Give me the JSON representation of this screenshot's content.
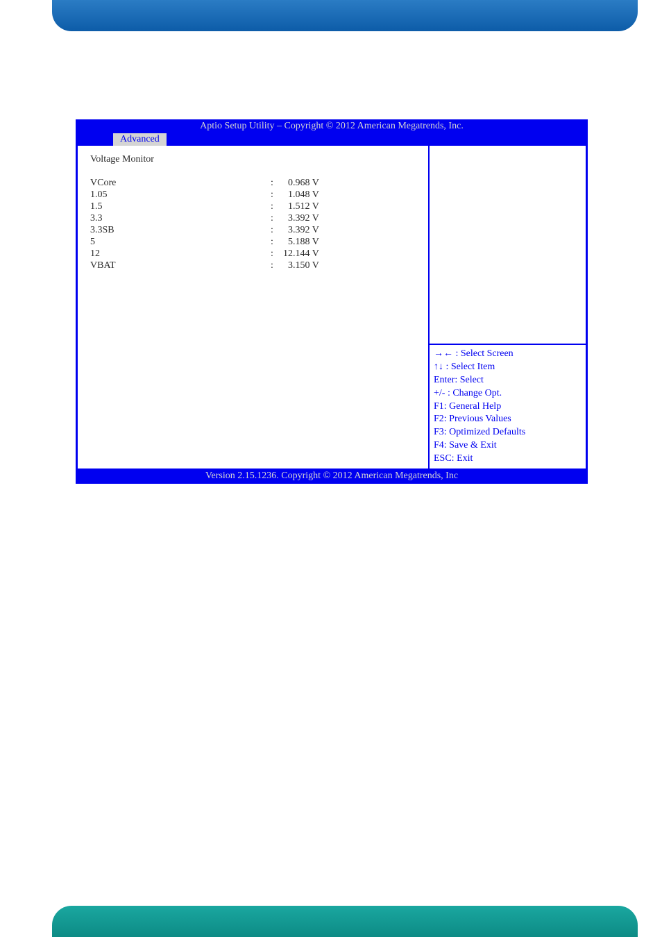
{
  "header": {
    "title": "Aptio Setup Utility  –  Copyright © 2012 American Megatrends, Inc."
  },
  "tabs": [
    {
      "label": "Advanced"
    }
  ],
  "main": {
    "section_title": "Voltage Monitor",
    "readings": [
      {
        "label": "VCore",
        "value": "  0.968 V"
      },
      {
        "label": "1.05",
        "value": "  1.048 V"
      },
      {
        "label": "1.5",
        "value": "  1.512 V"
      },
      {
        "label": "3.3",
        "value": "  3.392 V"
      },
      {
        "label": "3.3SB",
        "value": "  3.392 V"
      },
      {
        "label": "5",
        "value": "  5.188 V"
      },
      {
        "label": "12",
        "value": "12.144 V"
      },
      {
        "label": "VBAT",
        "value": "  3.150 V"
      }
    ]
  },
  "help": {
    "lines": [
      "→← : Select Screen",
      "↑↓ : Select Item",
      "Enter: Select",
      "+/- : Change Opt.",
      "F1: General Help",
      "F2: Previous Values",
      "F3: Optimized Defaults",
      "F4: Save & Exit",
      "ESC: Exit"
    ]
  },
  "footer": {
    "text": "Version 2.15.1236. Copyright © 2012 American Megatrends, Inc"
  }
}
